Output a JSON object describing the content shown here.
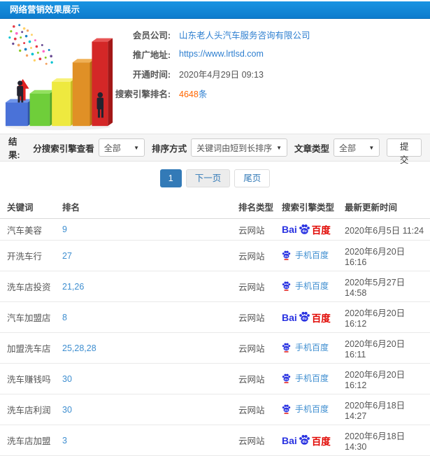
{
  "colors": {
    "header_blue": "#1287d9",
    "link_blue": "#2e7fd0",
    "highlight_orange": "#ff6600",
    "pagination_blue": "#337ab7",
    "rank_blue": "#3e8ed0",
    "baidu_blue": "#2932e1",
    "baidu_red": "#e10601",
    "filter_bg": "#f5f5f5"
  },
  "icons": {
    "caret_down": "▼"
  },
  "header": {
    "title": "网络营销效果展示"
  },
  "graphic": {
    "name": "3d-growth-bar-chart-illustration"
  },
  "account": {
    "company": {
      "label": "会员公司:",
      "value": "山东老人头汽车服务咨询有限公司"
    },
    "url": {
      "label": "推广地址:",
      "value": "https://www.lrtlsd.com"
    },
    "opened": {
      "label": "开通时间:",
      "value": "2020年4月29日 09:13"
    },
    "rank_count": {
      "label": "搜索引擎排名:",
      "value": "4648",
      "unit": "条"
    }
  },
  "filters": {
    "section_label": "结果:",
    "engine": {
      "label": "分搜索引擎查看",
      "value": "全部"
    },
    "sort": {
      "label": "排序方式",
      "value": "关键词由短到长排序"
    },
    "article_type": {
      "label": "文章类型",
      "value": "全部"
    },
    "submit_label": "提交"
  },
  "pagination": {
    "current": "1",
    "next_label": "下一页",
    "last_label": "尾页"
  },
  "logos": {
    "baidu_pc": {
      "name": "baidu-logo",
      "prefix": "Bai",
      "suffix": "百度"
    },
    "baidu_mobile": {
      "name": "mobile-baidu-badge",
      "label": "手机百度"
    }
  },
  "table": {
    "headers": [
      "关键词",
      "排名",
      "排名类型",
      "搜索引擎类型",
      "最新更新时间"
    ],
    "rows": [
      {
        "keyword": "汽车美容",
        "rank": "9",
        "rank_type": "云网站",
        "engine": "baidu_pc",
        "updated": "2020年6月5日 11:24"
      },
      {
        "keyword": "开洗车行",
        "rank": "27",
        "rank_type": "云网站",
        "engine": "baidu_mobile",
        "updated": "2020年6月20日 16:16"
      },
      {
        "keyword": "洗车店投资",
        "rank": "21,26",
        "rank_type": "云网站",
        "engine": "baidu_mobile",
        "updated": "2020年5月27日 14:58"
      },
      {
        "keyword": "汽车加盟店",
        "rank": "8",
        "rank_type": "云网站",
        "engine": "baidu_pc",
        "updated": "2020年6月20日 16:12"
      },
      {
        "keyword": "加盟洗车店",
        "rank": "25,28,28",
        "rank_type": "云网站",
        "engine": "baidu_mobile",
        "updated": "2020年6月20日 16:11"
      },
      {
        "keyword": "洗车赚钱吗",
        "rank": "30",
        "rank_type": "云网站",
        "engine": "baidu_mobile",
        "updated": "2020年6月20日 16:12"
      },
      {
        "keyword": "洗车店利润",
        "rank": "30",
        "rank_type": "云网站",
        "engine": "baidu_mobile",
        "updated": "2020年6月18日 14:27"
      },
      {
        "keyword": "洗车店加盟",
        "rank": "3",
        "rank_type": "云网站",
        "engine": "baidu_pc",
        "updated": "2020年6月18日 14:30"
      }
    ]
  }
}
